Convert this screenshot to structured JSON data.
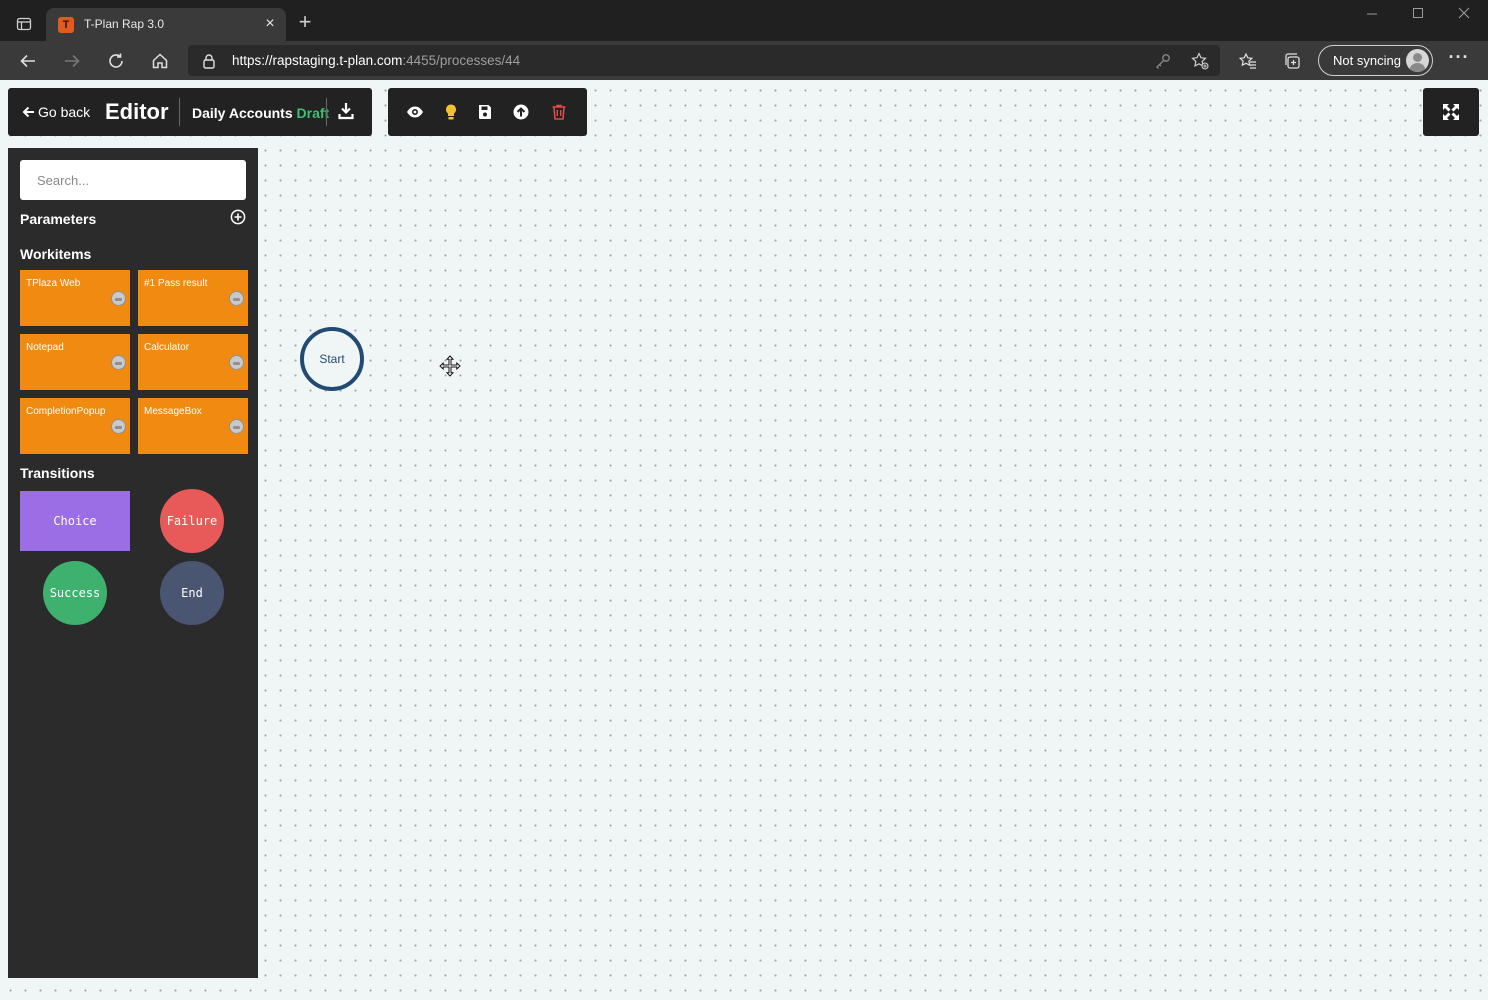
{
  "browser": {
    "tab_title": "T-Plan Rap 3.0",
    "tab_favicon_letter": "T",
    "url_prefix": "https://",
    "url_host": "rapstaging.t-plan.com",
    "url_path": ":4455/processes/44",
    "profile_label": "Not syncing"
  },
  "toolbar": {
    "go_back_label": "Go back",
    "editor_title": "Editor",
    "process_name": "Daily Accounts",
    "process_status": "Draft",
    "status_color": "#3fbf72"
  },
  "sidebar": {
    "search_placeholder": "Search...",
    "parameters_title": "Parameters",
    "workitems_title": "Workitems",
    "workitems": [
      {
        "label": "TPlaza Web"
      },
      {
        "label": "#1 Pass result"
      },
      {
        "label": "Notepad"
      },
      {
        "label": "Calculator"
      },
      {
        "label": "CompletionPopup"
      },
      {
        "label": "MessageBox"
      }
    ],
    "transitions_title": "Transitions",
    "transitions": [
      {
        "label": "Choice",
        "color": "#9b6ee6"
      },
      {
        "label": "Failure",
        "color": "#e85a5a"
      },
      {
        "label": "Success",
        "color": "#3fb16e"
      },
      {
        "label": "End",
        "color": "#4a5572"
      }
    ]
  },
  "canvas": {
    "start_node_label": "Start"
  },
  "colors": {
    "workitem": "#f08a10",
    "start_border": "#234a73",
    "delete_icon": "#e04a4a",
    "lightbulb_icon": "#f2c230"
  }
}
